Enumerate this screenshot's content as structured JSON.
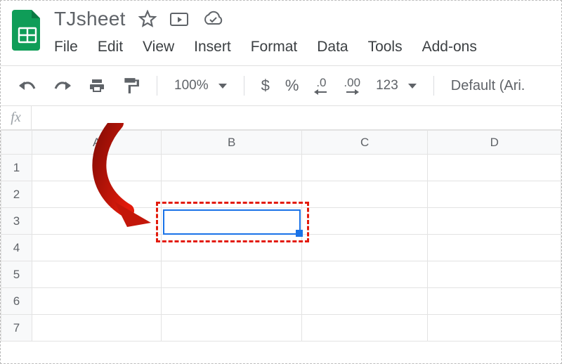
{
  "header": {
    "title": "TJsheet"
  },
  "menu": {
    "file": "File",
    "edit": "Edit",
    "view": "View",
    "insert": "Insert",
    "format": "Format",
    "data": "Data",
    "tools": "Tools",
    "addons": "Add-ons"
  },
  "toolbar": {
    "zoom": "100%",
    "currency": "$",
    "percent": "%",
    "dec_dec": ".0",
    "inc_dec": ".00",
    "more_formats": "123",
    "font": "Default (Ari."
  },
  "formula_bar": {
    "label": "fx",
    "value": ""
  },
  "grid": {
    "columns": [
      "A",
      "B",
      "C",
      "D"
    ],
    "rows": [
      "1",
      "2",
      "3",
      "4",
      "5",
      "6",
      "7"
    ],
    "selected_cell": "B3"
  }
}
